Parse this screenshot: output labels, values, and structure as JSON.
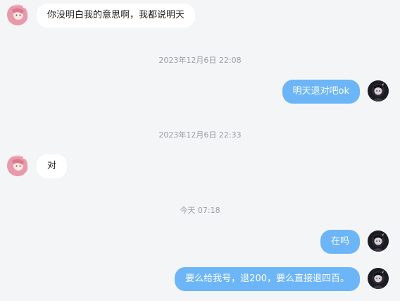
{
  "messages": [
    {
      "text": "你没明白我的意思啊，我都说明天",
      "avatar": "pink-haired-girl-avatar"
    },
    {
      "text": "明天退对吧ok",
      "avatar": "dark-anime-character-avatar"
    },
    {
      "text": "对",
      "avatar": "pink-haired-girl-avatar"
    },
    {
      "text": "在吗",
      "avatar": "dark-anime-character-avatar"
    },
    {
      "text": "要么给我号，退200，要么直接退四百。",
      "avatar": "dark-anime-character-avatar"
    }
  ],
  "timestamps": [
    "2023年12月6日 22:08",
    "2023年12月6日 22:33",
    "今天 07:18"
  ],
  "colors": {
    "background": "#f4f5f7",
    "incoming_bubble": "#ffffff",
    "outgoing_bubble": "#6cb5f7",
    "timestamp_text": "#9a9da3"
  }
}
